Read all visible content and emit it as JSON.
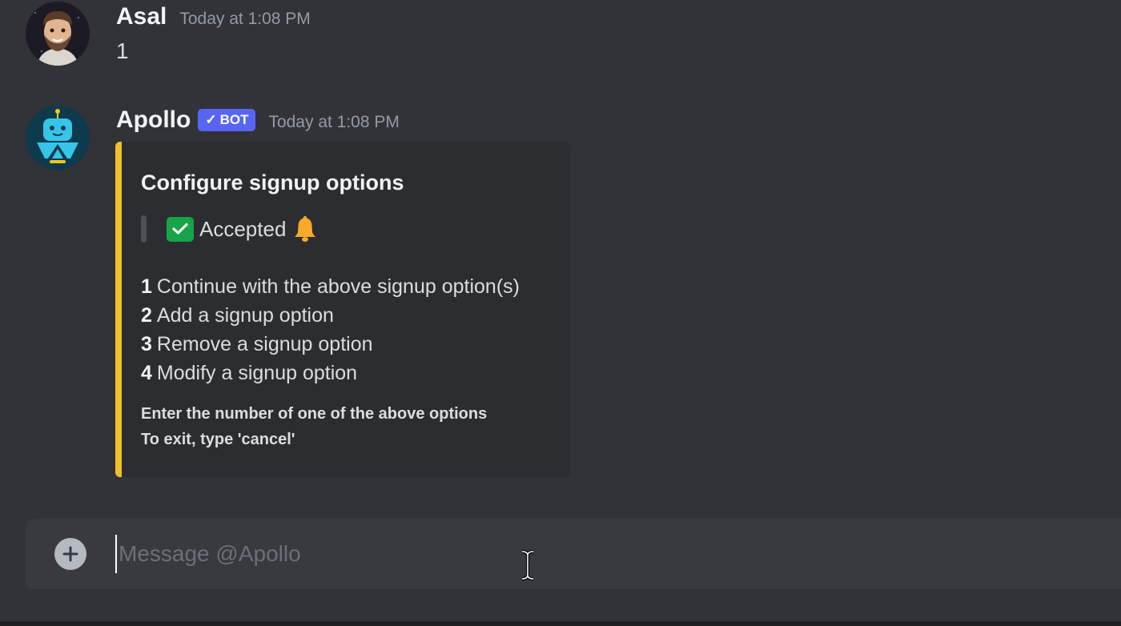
{
  "messages": [
    {
      "author": "Asal",
      "timestamp": "Today at 1:08 PM",
      "content": "1"
    },
    {
      "author": "Apollo",
      "bot_tag": "BOT",
      "timestamp": "Today at 1:08 PM",
      "embed": {
        "accent_color": "#f0c02c",
        "title": "Configure signup options",
        "quote": {
          "icon": "white-check-mark-icon",
          "text": "Accepted",
          "trailing_icon": "bell-icon"
        },
        "options": [
          {
            "number": "1",
            "text": "Continue with the above signup option(s)"
          },
          {
            "number": "2",
            "text": "Add a signup option"
          },
          {
            "number": "3",
            "text": "Remove a signup option"
          },
          {
            "number": "4",
            "text": "Modify a signup option"
          }
        ],
        "footer": [
          "Enter the number of one of the above options",
          "To exit, type 'cancel'"
        ]
      }
    }
  ],
  "composer": {
    "placeholder": "Message @Apollo",
    "value": ""
  },
  "colors": {
    "background": "#313338",
    "bot_tag": "#5865f2",
    "embed_bg": "#2b2d31",
    "composer_bg": "#383a40"
  }
}
